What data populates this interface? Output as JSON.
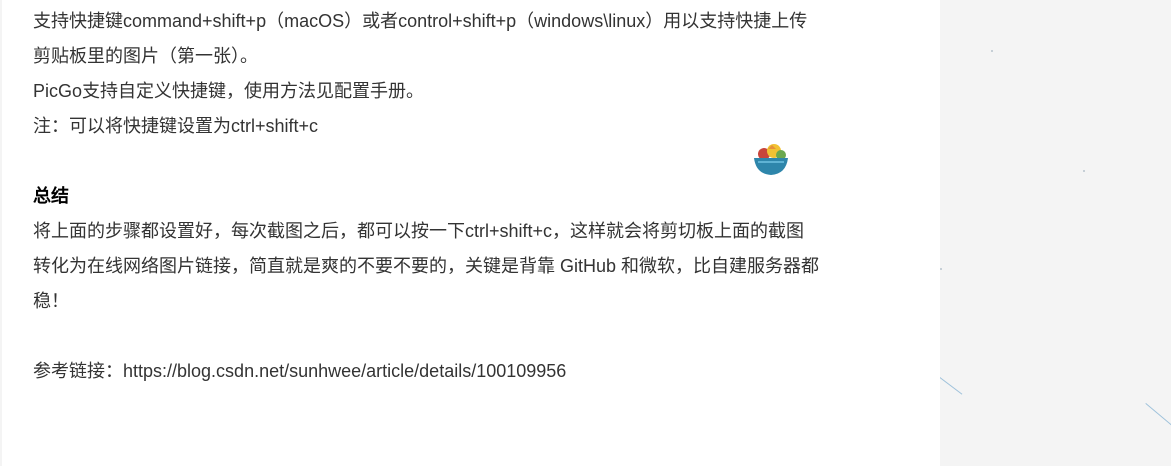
{
  "article": {
    "paragraphs": {
      "p1_line1": "支持快捷键command+shift+p（macOS）或者control+shift+p（windows\\linux）用以支持快捷上传",
      "p1_line2": "剪贴板里的图片（第一张）。",
      "p2": "PicGo支持自定义快捷键，使用方法见配置手册。",
      "p3": "注：可以将快捷键设置为ctrl+shift+c",
      "summary_heading": "总结",
      "summary_line1": "将上面的步骤都设置好，每次截图之后，都可以按一下ctrl+shift+c，这样就会将剪切板上面的截图",
      "summary_line2": "转化为在线网络图片链接，简直就是爽的不要不要的，关键是背靠 GitHub 和微软，比自建服务器都",
      "summary_line3": "稳！",
      "reference": "参考链接：https://blog.csdn.net/sunhwee/article/details/100109956"
    }
  },
  "decorations": {
    "mascot": "food-bowl-icon"
  },
  "colors": {
    "text": "#333333",
    "heading": "#000000",
    "background": "#f4f4f4",
    "article_background": "#ffffff",
    "accent_line": "#9fc2db"
  }
}
